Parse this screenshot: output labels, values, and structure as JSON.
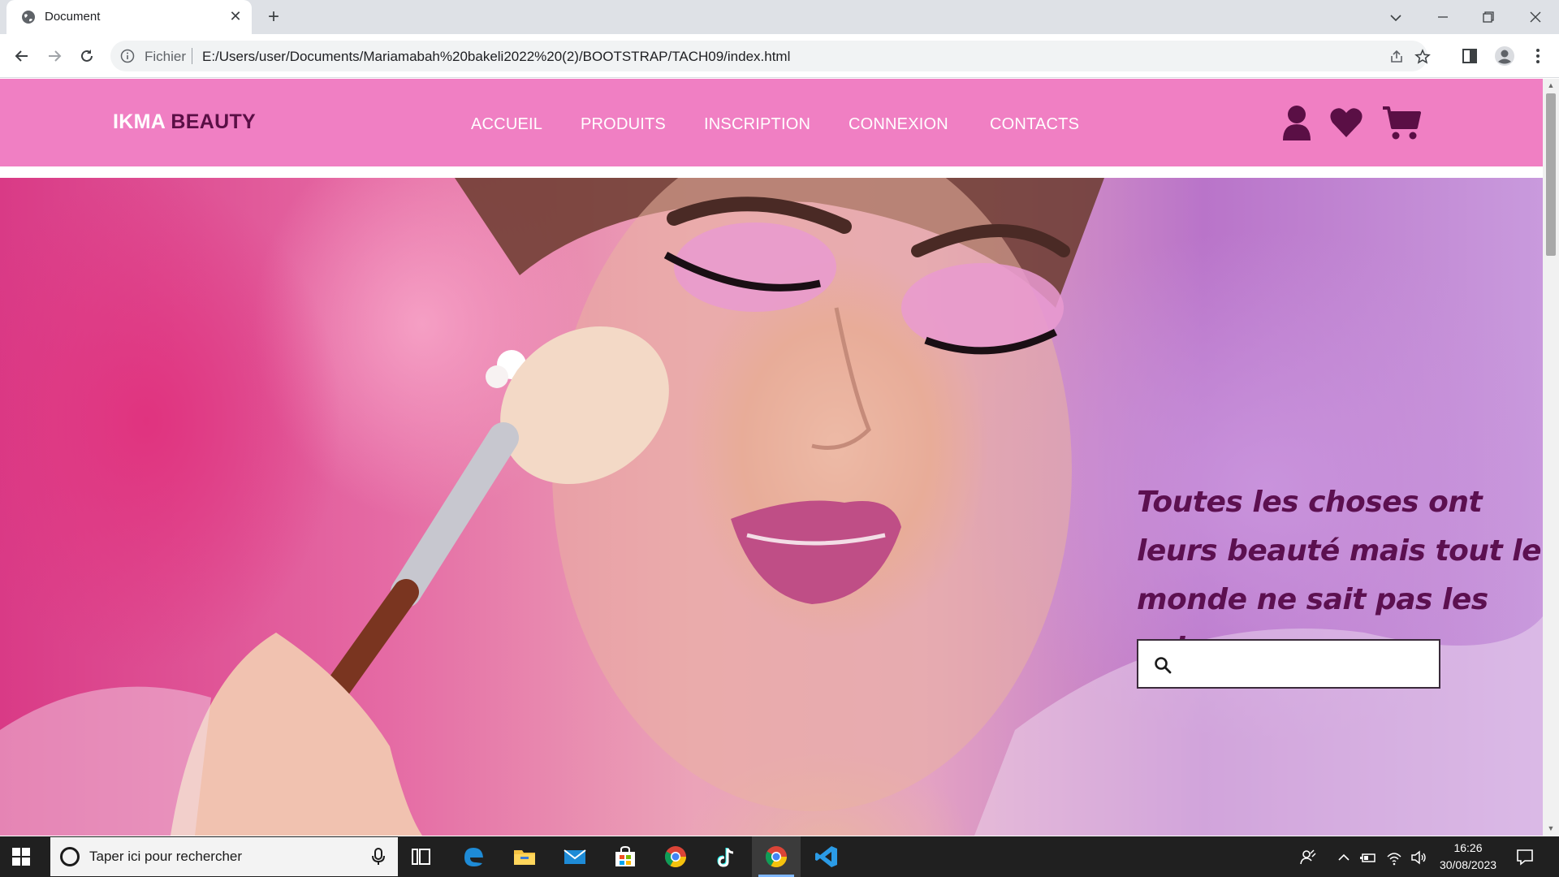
{
  "browser": {
    "tab_title": "Document",
    "address_prefix": "Fichier",
    "url": "E:/Users/user/Documents/Mariamabah%20bakeli2022%20(2)/BOOTSTRAP/TACH09/index.html"
  },
  "site": {
    "logo_part1": "IKMA",
    "logo_part2": "BEAUTY",
    "menu": [
      "ACCUEIL",
      "PRODUITS",
      "INSCRIPTION",
      "CONNEXION",
      "CONTACTS"
    ],
    "header_icons": [
      "user-icon",
      "heart-icon",
      "cart-icon"
    ],
    "hero_quote": "Toutes les choses ont leurs beauté mais tout le monde ne sait pas les voir",
    "search_placeholder": "",
    "colors": {
      "header_bg": "#f07fc3",
      "logo_accent": "#5a0f45",
      "quote": "#5c1050"
    }
  },
  "taskbar": {
    "search_placeholder": "Taper ici pour rechercher",
    "time": "16:26",
    "date": "30/08/2023",
    "apps": [
      "task-view-icon",
      "edge-icon",
      "file-explorer-icon",
      "mail-icon",
      "store-icon",
      "chrome-icon",
      "tiktok-icon",
      "chrome-icon",
      "vscode-icon"
    ]
  }
}
